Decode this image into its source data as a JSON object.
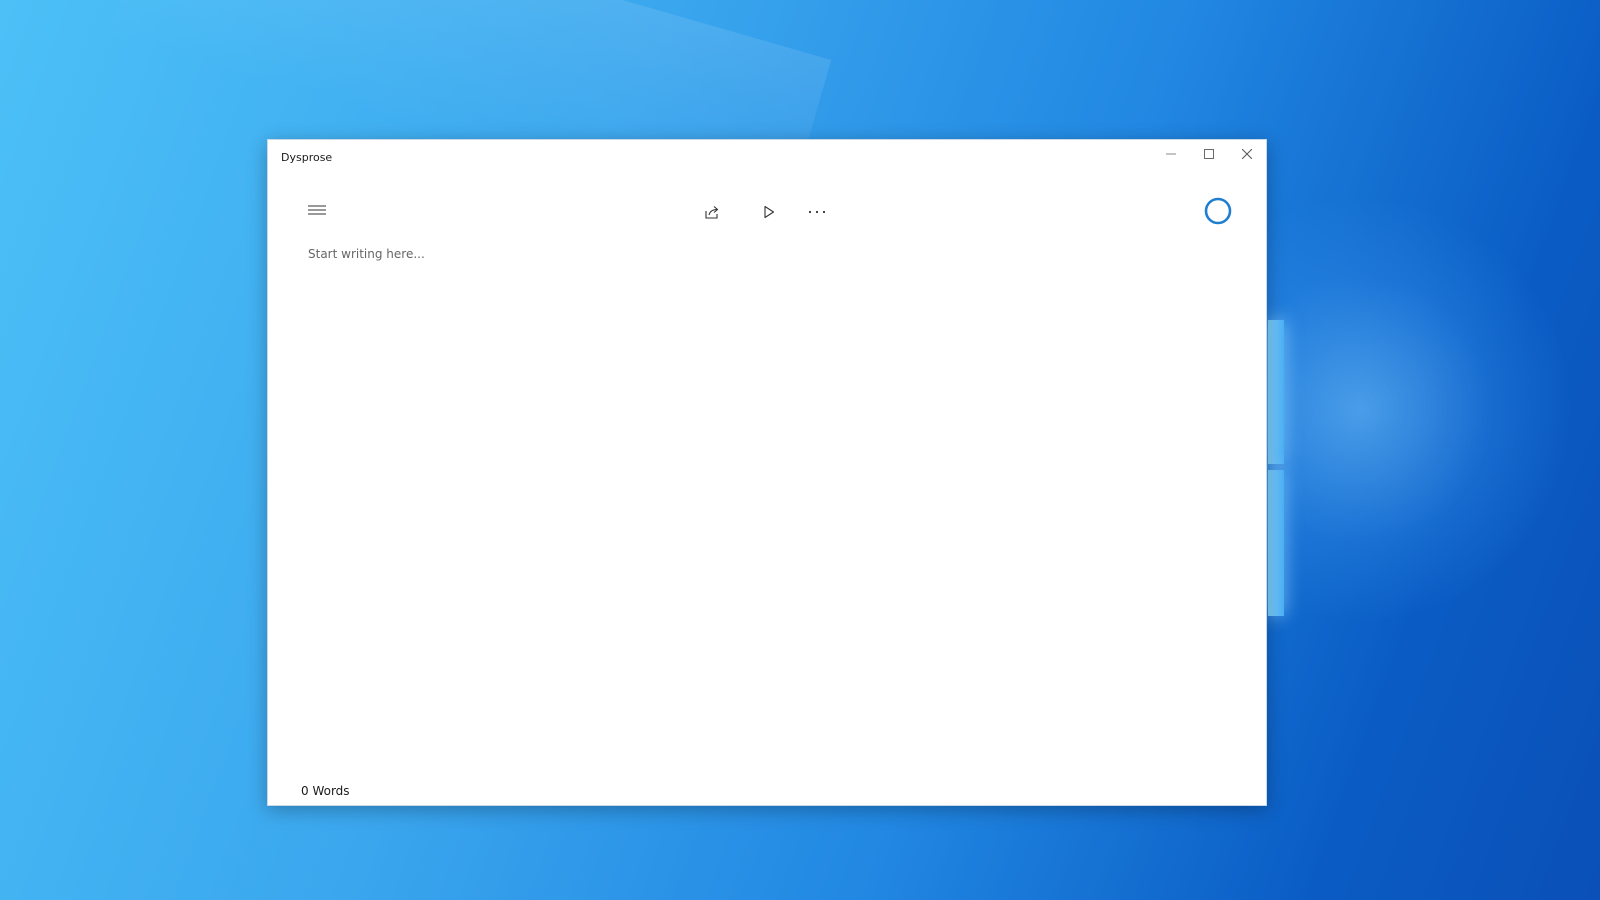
{
  "window": {
    "title": "Dysprose"
  },
  "toolbar": {
    "menu_icon": "hamburger-menu-icon",
    "share_icon": "share-icon",
    "play_icon": "play-icon",
    "more_icon": "more-options-icon",
    "status_icon": "circle-ring-icon"
  },
  "editor": {
    "placeholder": "Start writing here...",
    "value": ""
  },
  "status": {
    "word_count": "0 Words"
  },
  "colors": {
    "accent": "#1f7ed0",
    "window_bg": "#ffffff",
    "desktop_light": "#4cc0f7",
    "desktop_dark": "#0a50b8"
  }
}
